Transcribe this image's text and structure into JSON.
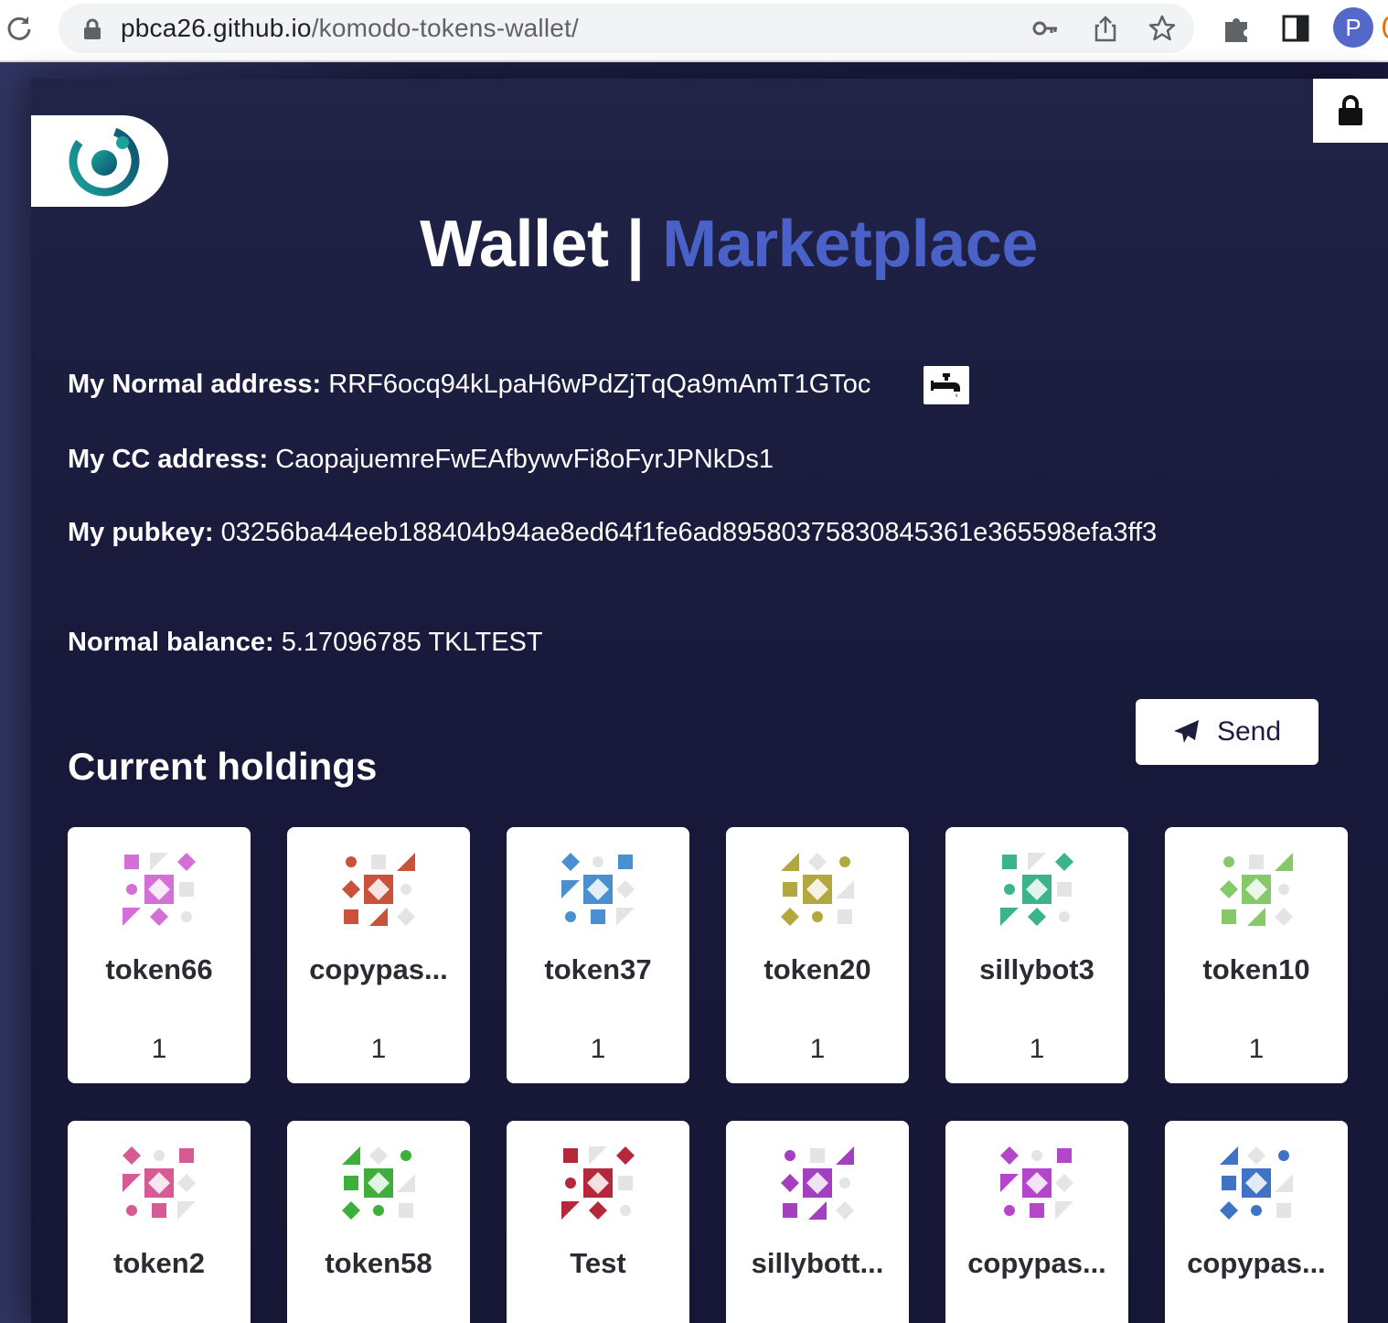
{
  "browser": {
    "url_host": "pbca26.github.io",
    "url_path": "/komodo-tokens-wallet/",
    "avatar_letter": "P"
  },
  "header": {
    "title_wallet": "Wallet",
    "title_separator": " | ",
    "title_marketplace": "Marketplace"
  },
  "account": {
    "normal_address_label": "My Normal address:",
    "normal_address": "RRF6ocq94kLpaH6wPdZjTqQa9mAmT1GToc",
    "cc_address_label": "My CC address:",
    "cc_address": "CaopajuemreFwEAfbywvFi8oFyrJPNkDs1",
    "pubkey_label": "My pubkey:",
    "pubkey": "03256ba44eeb188404b94ae8ed64f1fe6ad89580375830845361e365598efa3ff3",
    "balance_label": "Normal balance:",
    "balance": "5.17096785 TKLTEST"
  },
  "actions": {
    "send_label": "Send"
  },
  "holdings": {
    "title": "Current holdings",
    "tokens": [
      {
        "name": "token66",
        "amount": "1",
        "color": "#d36fd6"
      },
      {
        "name": "copypas...",
        "amount": "1",
        "color": "#c8533a"
      },
      {
        "name": "token37",
        "amount": "1",
        "color": "#4a8fd0"
      },
      {
        "name": "token20",
        "amount": "1",
        "color": "#b3a840"
      },
      {
        "name": "sillybot3",
        "amount": "1",
        "color": "#3bb48a"
      },
      {
        "name": "token10",
        "amount": "1",
        "color": "#86c96a"
      },
      {
        "name": "token2",
        "amount": "",
        "color": "#d65a93"
      },
      {
        "name": "token58",
        "amount": "",
        "color": "#3fae3a"
      },
      {
        "name": "Test",
        "amount": "",
        "color": "#b5283a"
      },
      {
        "name": "sillybott...",
        "amount": "",
        "color": "#a340c0"
      },
      {
        "name": "copypas...",
        "amount": "",
        "color": "#b546c9"
      },
      {
        "name": "copypas...",
        "amount": "",
        "color": "#3f74c4"
      }
    ]
  }
}
